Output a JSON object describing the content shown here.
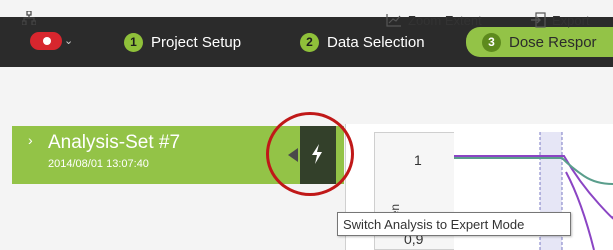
{
  "workflow": {
    "steps": [
      {
        "number": "1",
        "label": "Project Setup"
      },
      {
        "number": "2",
        "label": "Data Selection"
      },
      {
        "number": "3",
        "label": "Dose Respor"
      }
    ]
  },
  "toolbar": {
    "zoom_label": "Zoom Extent",
    "export_label": "Export"
  },
  "analysis": {
    "title": "Analysis-Set #7",
    "date": "2014/08/01 13:07:40"
  },
  "chart": {
    "ticks": [
      "1",
      "0,9"
    ],
    "ylabel": "escen"
  },
  "tooltip": {
    "text": "Switch Analysis to Expert Mode"
  },
  "colors": {
    "accent_green": "#93c347",
    "dark_bar": "#2b2b2b",
    "app_red": "#d7262e",
    "annotation_red": "#c01818"
  }
}
